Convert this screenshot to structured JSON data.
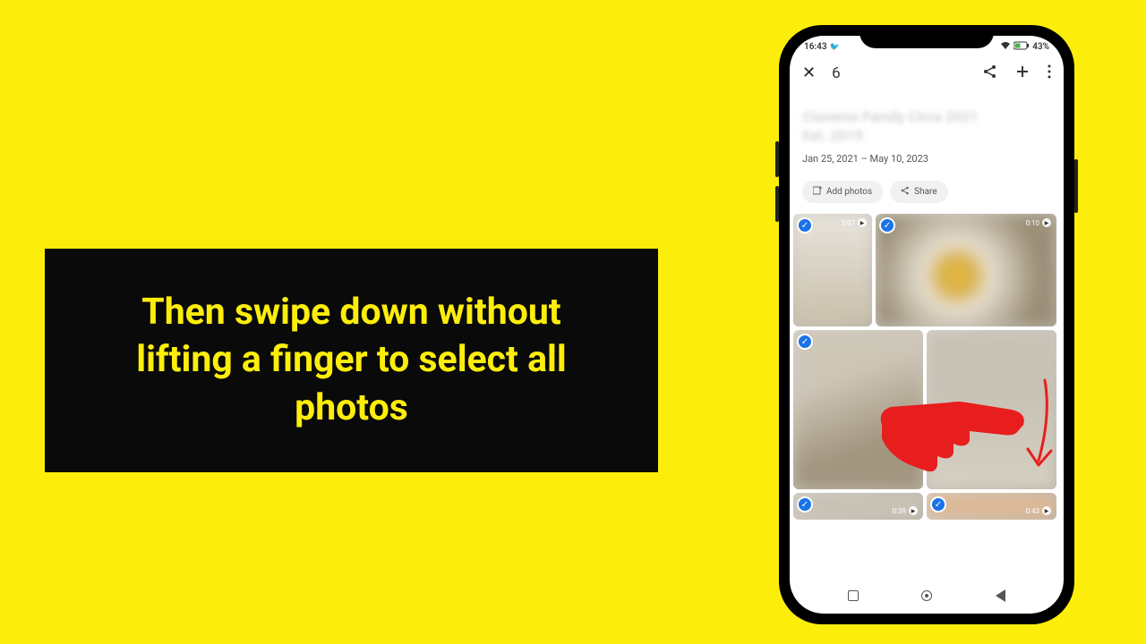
{
  "instruction": "Then swipe down without lifting a finger to select all photos",
  "status_bar": {
    "time": "16:43",
    "battery": "43%"
  },
  "app_header": {
    "selection_count": "6"
  },
  "album": {
    "title_line1": "Cisneros Family Circa 2021",
    "title_line2": "Est. 2019",
    "date_range": "Jan 25, 2021 – May 10, 2023"
  },
  "chips": {
    "add_photos": "Add photos",
    "share": "Share"
  },
  "photos": [
    {
      "duration": "5:07"
    },
    {
      "duration": "0:10"
    },
    {
      "duration": ""
    },
    {
      "duration": ""
    },
    {
      "duration": "0:39"
    },
    {
      "duration": "0:43"
    }
  ]
}
